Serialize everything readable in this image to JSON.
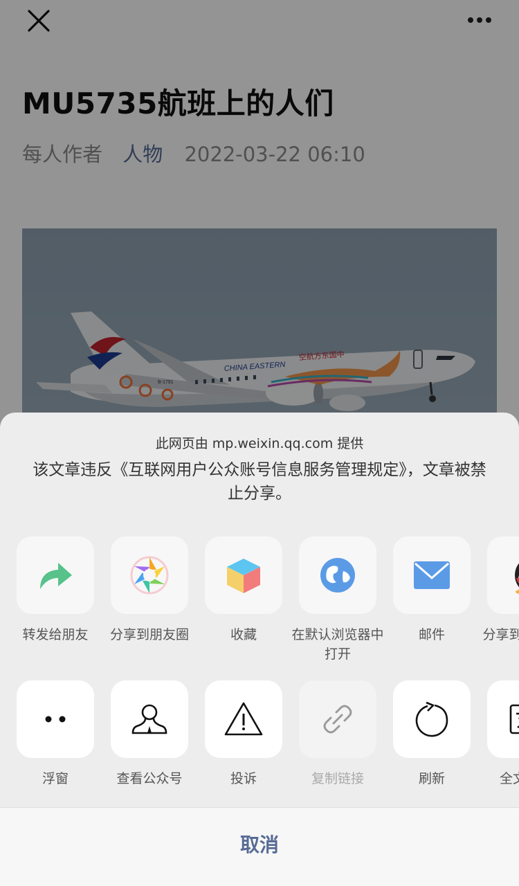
{
  "header": {
    "close_icon": "close-icon",
    "more_icon": "more-icon"
  },
  "article": {
    "title": "MU5735航班上的人们",
    "author": "每人作者",
    "account": "人物",
    "datetime": "2022-03-22 06:10",
    "photo_text": {
      "airline_name": "CHINA EASTERN",
      "airline_cn": "空航方东国中",
      "registration": "B-1791"
    }
  },
  "share_sheet": {
    "provider": "此网页由 mp.weixin.qq.com 提供",
    "notice": "该文章违反《互联网用户公众账号信息服务管理规定》，文章被禁止分享。",
    "row1": [
      {
        "label": "转发给朋友",
        "icon": "forward-arrow-icon",
        "color": "#57c28a"
      },
      {
        "label": "分享到朋友圈",
        "icon": "moments-icon"
      },
      {
        "label": "收藏",
        "icon": "favorite-cube-icon"
      },
      {
        "label": "在默认浏览器中打开",
        "icon": "browser-globe-icon",
        "color": "#5b9be6"
      },
      {
        "label": "邮件",
        "icon": "mail-icon",
        "color": "#5b9be6"
      },
      {
        "label": "分享到手机QQ",
        "icon": "qq-penguin-icon"
      }
    ],
    "row2": [
      {
        "label": "浮窗",
        "icon": "float-window-icon"
      },
      {
        "label": "查看公众号",
        "icon": "official-account-icon"
      },
      {
        "label": "投诉",
        "icon": "warning-icon"
      },
      {
        "label": "复制链接",
        "icon": "link-icon",
        "disabled": true
      },
      {
        "label": "刷新",
        "icon": "refresh-icon"
      },
      {
        "label": "全文翻译",
        "icon": "translate-icon"
      }
    ],
    "cancel_label": "取消"
  },
  "colors": {
    "link_blue": "#576b95",
    "sheet_bg": "#ededed",
    "overlay": "rgba(0,0,0,0.42)"
  }
}
